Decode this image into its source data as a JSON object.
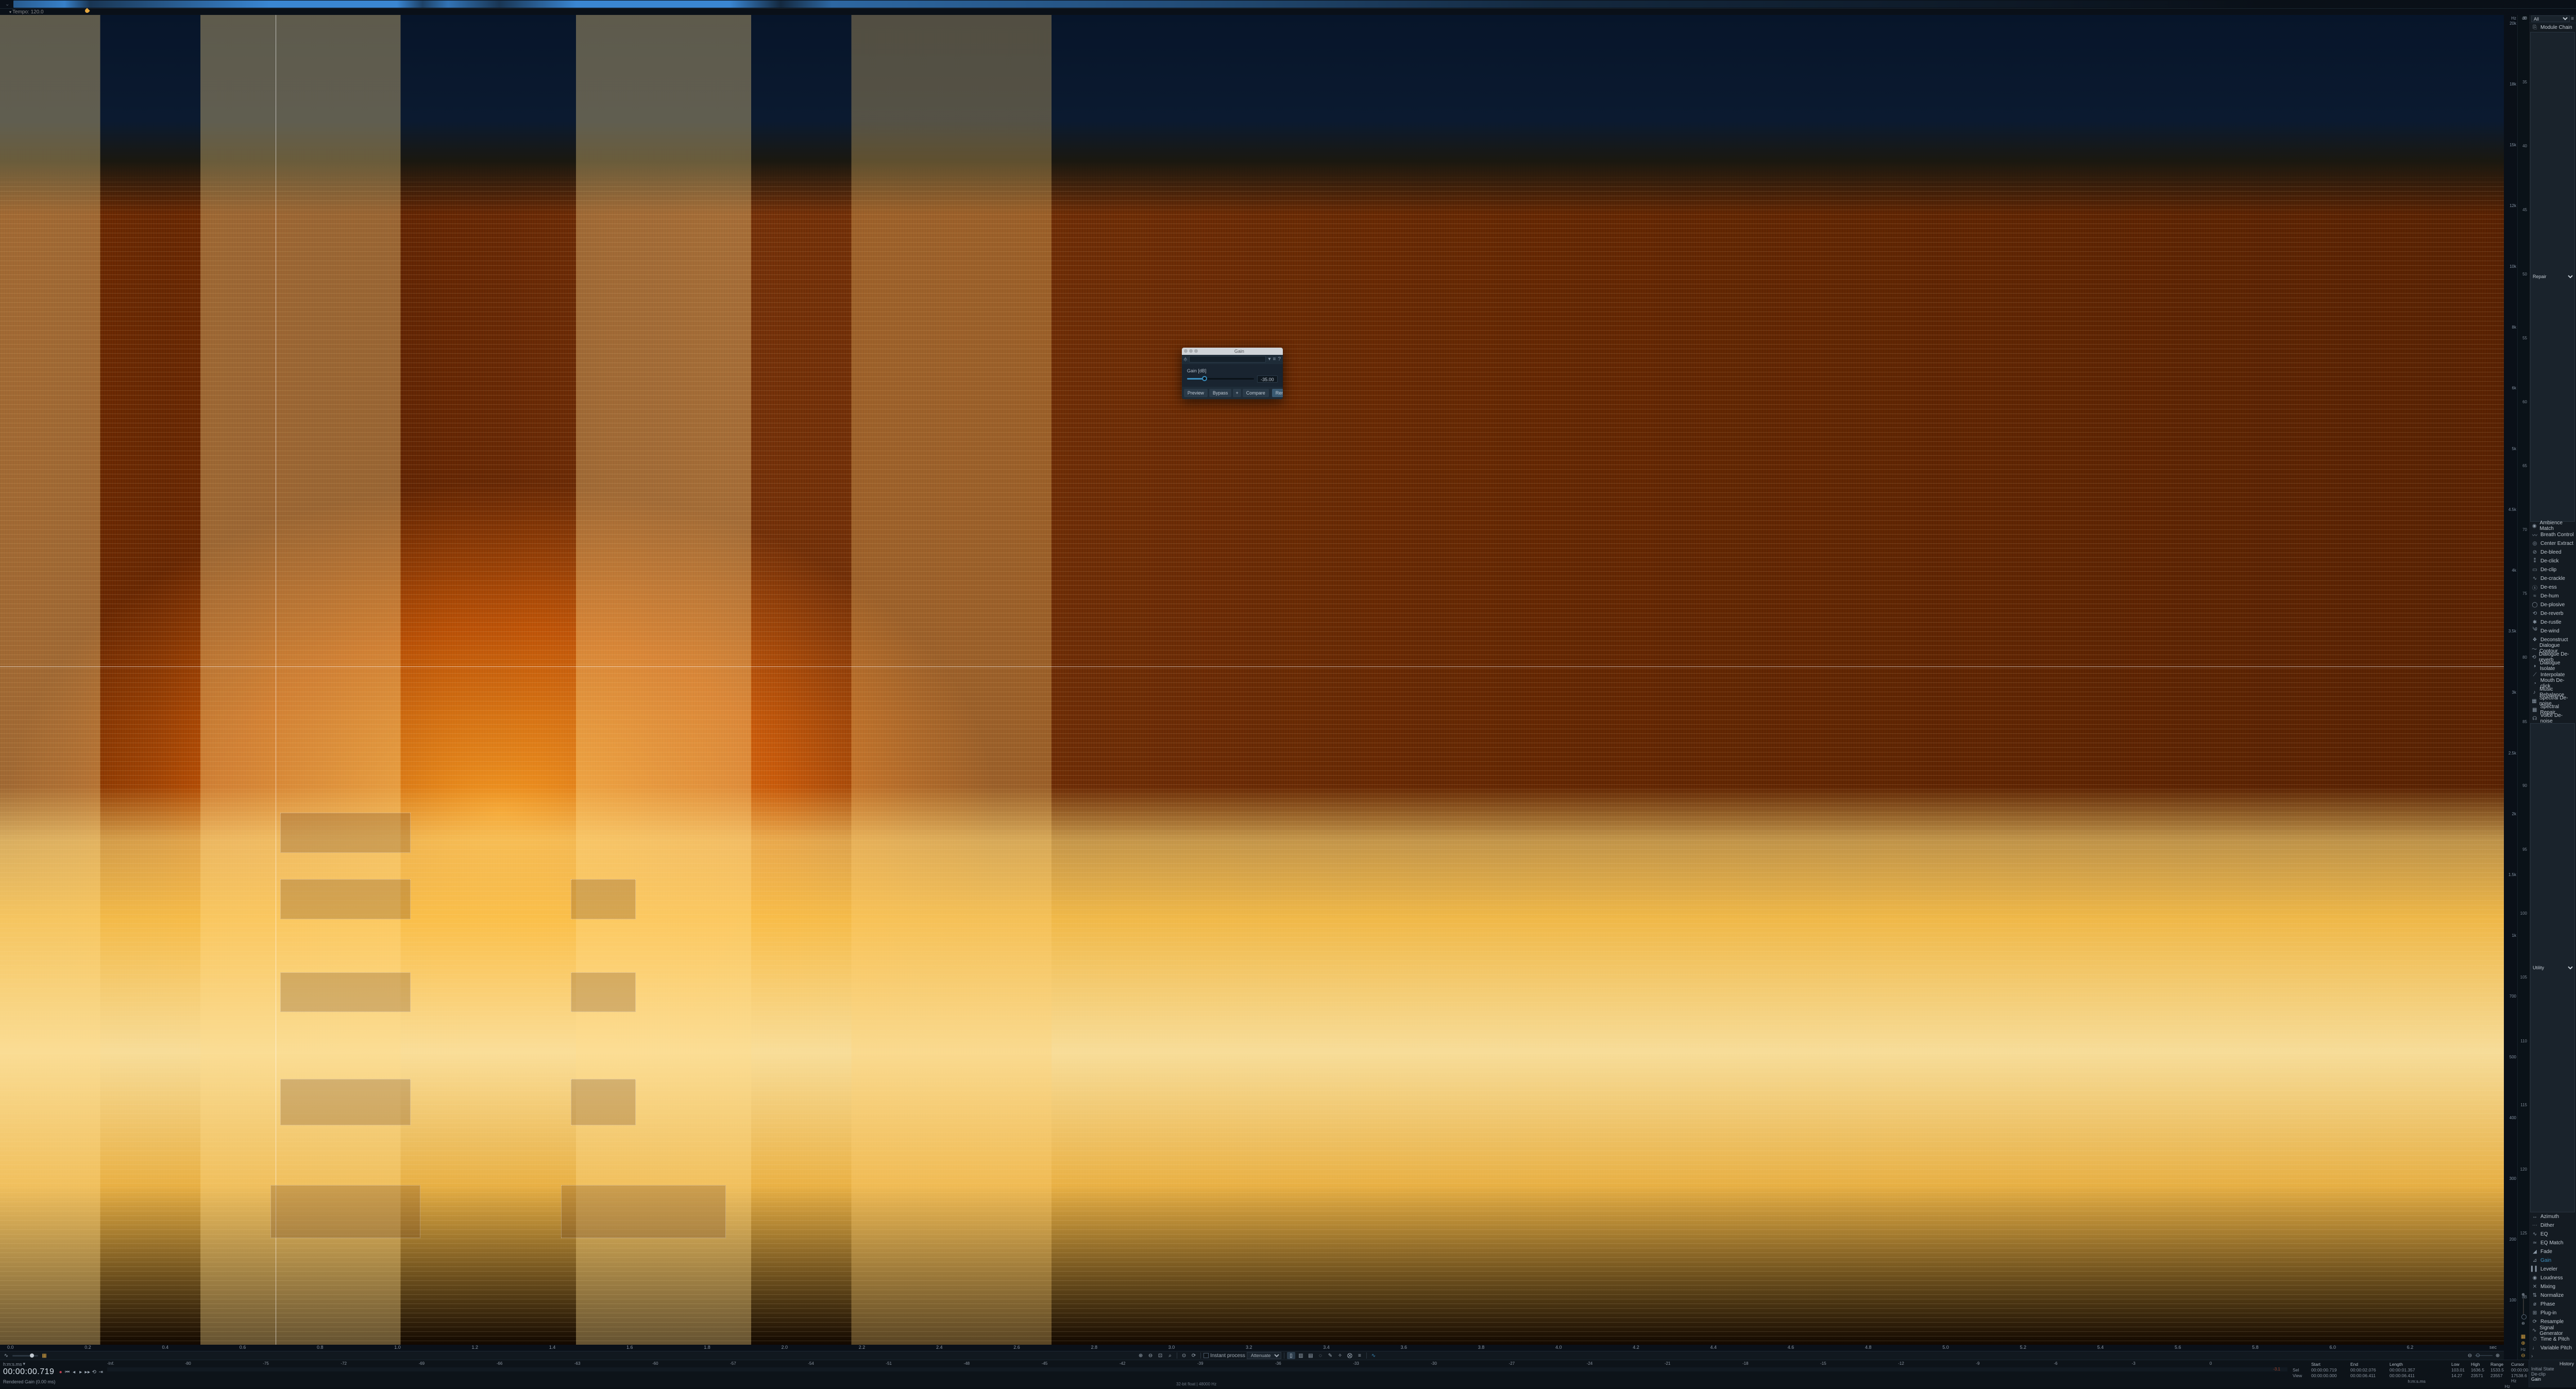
{
  "topbar": {
    "tempo_label": "Tempo: 120.0"
  },
  "modal": {
    "title": "Gain",
    "param_label": "Gain [dB]",
    "value": "-35.00",
    "buttons": {
      "preview": "Preview",
      "bypass": "Bypass",
      "plus": "+",
      "compare": "Compare",
      "render": "Render"
    }
  },
  "freq_axis": [
    "20k",
    "18k",
    "15k",
    "12k",
    "10k",
    "8k",
    "6k",
    "5k",
    "4.5k",
    "4k",
    "3.5k",
    "3k",
    "2.5k",
    "2k",
    "1.5k",
    "1k",
    "700",
    "500",
    "400",
    "300",
    "200",
    "100"
  ],
  "freq_unit_top": "Hz",
  "db_axis": {
    "label": "dB",
    "ticks": [
      "30",
      "35",
      "40",
      "45",
      "50",
      "55",
      "60",
      "65",
      "70",
      "75",
      "80",
      "85",
      "90",
      "95",
      "100",
      "105",
      "110",
      "115",
      "120",
      "125",
      "dB"
    ],
    "unit_bottom": "Hz"
  },
  "time_ruler": [
    "0.0",
    "0.2",
    "0.4",
    "0.6",
    "0.8",
    "1.0",
    "1.2",
    "1.4",
    "1.6",
    "1.8",
    "2.0",
    "2.2",
    "2.4",
    "2.6",
    "2.8",
    "3.0",
    "3.2",
    "3.4",
    "3.6",
    "3.8",
    "4.0",
    "4.2",
    "4.4",
    "4.6",
    "4.8",
    "5.0",
    "5.2",
    "5.4",
    "5.6",
    "5.8",
    "6.0",
    "6.2"
  ],
  "time_unit": "sec",
  "toolbar": {
    "process_label": "Instant process",
    "attenuate": "Attenuate"
  },
  "sidebar": {
    "filter_all": "All",
    "module_chain": "Module Chain",
    "repair_label": "Repair",
    "repair": [
      "Ambience Match",
      "Breath Control",
      "Center Extract",
      "De-bleed",
      "De-click",
      "De-clip",
      "De-crackle",
      "De-ess",
      "De-hum",
      "De-plosive",
      "De-reverb",
      "De-rustle",
      "De-wind",
      "Deconstruct",
      "Dialogue Contour",
      "Dialogue De-reverb",
      "Dialogue Isolate",
      "Interpolate",
      "Mouth De-click",
      "Music Rebalance",
      "Spectral De-noise",
      "Spectral Repair",
      "Voice De-noise"
    ],
    "utility_label": "Utility",
    "utility": [
      "Azimuth",
      "Dither",
      "EQ",
      "EQ Match",
      "Fade",
      "Gain",
      "Leveler",
      "Loudness",
      "Mixing",
      "Normalize",
      "Phase",
      "Plug-in",
      "Resample",
      "Signal Generator",
      "Time & Pitch",
      "Variable Pitch"
    ],
    "active": "Gain"
  },
  "status": {
    "units_label": "h:m:s.ms",
    "timecode": "00:00:00.719",
    "message": "Rendered Gain (0.00 ms)",
    "format": "32-bit float | 48000 Hz"
  },
  "meter_ruler": [
    "-Inf.",
    "-80",
    "-75",
    "-72",
    "-69",
    "-66",
    "-63",
    "-60",
    "-57",
    "-54",
    "-51",
    "-48",
    "-45",
    "-42",
    "-39",
    "-36",
    "-33",
    "-30",
    "-27",
    "-24",
    "-21",
    "-18",
    "-15",
    "-12",
    "-9",
    "-6",
    "-3",
    "0"
  ],
  "meter_peak": "-3.1",
  "info": {
    "headers": [
      "Start",
      "End",
      "Length"
    ],
    "sel_label": "Sel",
    "view_label": "View",
    "sel": [
      "00:00:00.719",
      "00:00:02.076",
      "00:00:01.357"
    ],
    "view": [
      "00:00:00.000",
      "00:00:06.411",
      "00:00:06.411"
    ],
    "units_row": "h:m:s.ms"
  },
  "info2": {
    "headers": [
      "Low",
      "High",
      "Range",
      "Cursor"
    ],
    "row1": [
      "103.01",
      "1636.5",
      "1533.5",
      "00:00:00.093"
    ],
    "row2": [
      "14.27",
      "23571",
      "23557",
      "17538.6 Hz"
    ],
    "unit": "Hz"
  },
  "history": {
    "title": "History",
    "items": [
      "Initial State",
      "De-clip",
      "Gain"
    ],
    "active": "Gain"
  }
}
